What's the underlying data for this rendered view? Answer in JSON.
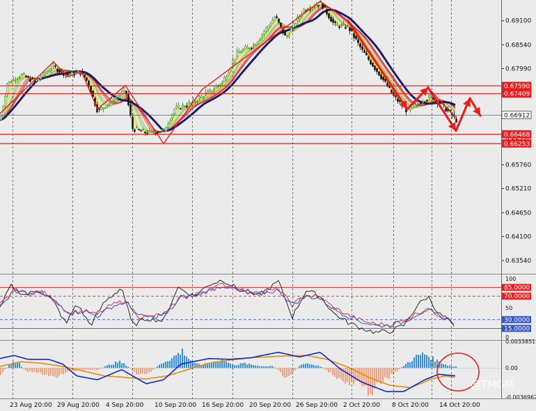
{
  "watermark": "@TMGM",
  "colors": {
    "background": "#ebebeb",
    "bull_candle": "#2a8a2a",
    "bear_candle": "#111111",
    "ma_slow": "#1c1c6b",
    "zigzag": "#ee1c1c",
    "hline_red": "#ee1c1c",
    "hline_blue": "#3355cc",
    "macd_line": "#0a2ad0",
    "signal_line": "#f08a00",
    "hist_pos": "#2f8fe0",
    "hist_neg": "#f4a07a",
    "stoch_black": "#111111",
    "stoch_red": "#e02020",
    "stoch_blue": "#2040d0"
  },
  "chart_data": [
    {
      "type": "candlestick",
      "panel": "price",
      "y_ticks": [
        "0.69100",
        "0.68540",
        "0.67990",
        "0.67440",
        "0.66890",
        "0.66340",
        "0.65760",
        "0.65210",
        "0.64650",
        "0.64100",
        "0.63540"
      ],
      "ylim": [
        0.6325,
        0.6958
      ],
      "x_ticks": [
        "23 Aug 20:00",
        "29 Aug 20:00",
        "4 Sep 20:00",
        "10 Sep 20:00",
        "16 Sep 20:00",
        "20 Sep 20:00",
        "26 Sep 20:00",
        "2 Oct 20:00",
        "8 Oct 20:00",
        "14 Oct 20:00"
      ],
      "price_path": [
        [
          0,
          0.668
        ],
        [
          10,
          0.6765
        ],
        [
          30,
          0.6785
        ],
        [
          50,
          0.6768
        ],
        [
          75,
          0.6805
        ],
        [
          95,
          0.6785
        ],
        [
          115,
          0.679
        ],
        [
          125,
          0.677
        ],
        [
          140,
          0.67
        ],
        [
          160,
          0.6725
        ],
        [
          180,
          0.675
        ],
        [
          190,
          0.666
        ],
        [
          210,
          0.665
        ],
        [
          235,
          0.6655
        ],
        [
          250,
          0.6705
        ],
        [
          275,
          0.672
        ],
        [
          300,
          0.6745
        ],
        [
          320,
          0.677
        ],
        [
          340,
          0.6835
        ],
        [
          365,
          0.6855
        ],
        [
          395,
          0.692
        ],
        [
          410,
          0.687
        ],
        [
          435,
          0.6935
        ],
        [
          460,
          0.6952
        ],
        [
          480,
          0.69
        ],
        [
          500,
          0.6895
        ],
        [
          520,
          0.684
        ],
        [
          545,
          0.6785
        ],
        [
          565,
          0.6735
        ],
        [
          585,
          0.67
        ],
        [
          600,
          0.672
        ],
        [
          620,
          0.6735
        ],
        [
          640,
          0.6705
        ],
        [
          655,
          0.668
        ]
      ],
      "zigzag": [
        [
          0,
          0.6695
        ],
        [
          77,
          0.6815
        ],
        [
          97,
          0.678
        ],
        [
          117,
          0.6792
        ],
        [
          140,
          0.6705
        ],
        [
          180,
          0.676
        ],
        [
          235,
          0.6625
        ],
        [
          290,
          0.675
        ],
        [
          460,
          0.6955
        ],
        [
          500,
          0.691
        ],
        [
          585,
          0.6705
        ],
        [
          615,
          0.6755
        ],
        [
          655,
          0.6685
        ]
      ],
      "projection_arrows": [
        [
          [
            500,
            0.691
          ],
          [
            585,
            0.6705
          ]
        ],
        [
          [
            585,
            0.6705
          ],
          [
            615,
            0.6755
          ]
        ],
        [
          [
            615,
            0.6755
          ],
          [
            655,
            0.6655
          ]
        ],
        [
          [
            655,
            0.6655
          ],
          [
            675,
            0.673
          ]
        ],
        [
          [
            675,
            0.673
          ],
          [
            690,
            0.669
          ]
        ]
      ],
      "hlines": [
        {
          "value": 0.6759,
          "label": "0.67590",
          "color": "#ee1c1c"
        },
        {
          "value": 0.67409,
          "label": "0.67409",
          "color": "#ee1c1c"
        },
        {
          "value": 0.66912,
          "label": "0.66912",
          "color": "#3355cc",
          "current": true
        },
        {
          "value": 0.66468,
          "label": "0.66468",
          "color": "#ee1c1c"
        },
        {
          "value": 0.66253,
          "label": "0.66253",
          "color": "#ee1c1c"
        }
      ]
    },
    {
      "type": "line",
      "panel": "oscillator",
      "ylim": [
        0,
        100
      ],
      "y_ticks": [
        "100",
        "50",
        "0"
      ],
      "levels": [
        {
          "value": 85,
          "label": "85.0000",
          "color": "#ee1c1c",
          "dash": false
        },
        {
          "value": 70,
          "label": "70.0000",
          "color": "#ee1c1c",
          "dash": true
        },
        {
          "value": 30,
          "label": "30.0000",
          "color": "#3355cc",
          "dash": true
        },
        {
          "value": 15,
          "label": "15.0000",
          "color": "#3355cc",
          "dash": false
        }
      ],
      "series": [
        {
          "color": "#111111",
          "points": [
            [
              0,
              48
            ],
            [
              15,
              88
            ],
            [
              35,
              72
            ],
            [
              55,
              80
            ],
            [
              75,
              65
            ],
            [
              95,
              22
            ],
            [
              110,
              58
            ],
            [
              130,
              20
            ],
            [
              150,
              60
            ],
            [
              175,
              85
            ],
            [
              190,
              20
            ],
            [
              210,
              32
            ],
            [
              235,
              28
            ],
            [
              255,
              85
            ],
            [
              280,
              70
            ],
            [
              300,
              90
            ],
            [
              320,
              98
            ],
            [
              345,
              80
            ],
            [
              370,
              70
            ],
            [
              400,
              95
            ],
            [
              420,
              35
            ],
            [
              440,
              80
            ],
            [
              460,
              70
            ],
            [
              480,
              40
            ],
            [
              500,
              25
            ],
            [
              520,
              15
            ],
            [
              540,
              8
            ],
            [
              560,
              10
            ],
            [
              580,
              20
            ],
            [
              600,
              55
            ],
            [
              615,
              70
            ],
            [
              630,
              40
            ],
            [
              645,
              30
            ],
            [
              655,
              10
            ]
          ]
        },
        {
          "color": "#e02020",
          "points": [
            [
              0,
              55
            ],
            [
              20,
              80
            ],
            [
              40,
              75
            ],
            [
              60,
              78
            ],
            [
              80,
              62
            ],
            [
              100,
              40
            ],
            [
              120,
              45
            ],
            [
              140,
              38
            ],
            [
              160,
              55
            ],
            [
              180,
              62
            ],
            [
              200,
              35
            ],
            [
              220,
              35
            ],
            [
              240,
              42
            ],
            [
              260,
              70
            ],
            [
              280,
              72
            ],
            [
              300,
              82
            ],
            [
              320,
              90
            ],
            [
              345,
              82
            ],
            [
              370,
              75
            ],
            [
              400,
              82
            ],
            [
              420,
              55
            ],
            [
              440,
              72
            ],
            [
              460,
              68
            ],
            [
              480,
              50
            ],
            [
              500,
              38
            ],
            [
              520,
              28
            ],
            [
              540,
              22
            ],
            [
              560,
              22
            ],
            [
              580,
              28
            ],
            [
              600,
              42
            ],
            [
              615,
              48
            ],
            [
              630,
              38
            ],
            [
              645,
              32
            ],
            [
              655,
              22
            ]
          ]
        },
        {
          "color": "#2040d0",
          "points": [
            [
              0,
              52
            ],
            [
              20,
              78
            ],
            [
              40,
              74
            ],
            [
              60,
              76
            ],
            [
              80,
              60
            ],
            [
              100,
              42
            ],
            [
              120,
              45
            ],
            [
              140,
              36
            ],
            [
              160,
              52
            ],
            [
              180,
              60
            ],
            [
              200,
              36
            ],
            [
              220,
              34
            ],
            [
              240,
              40
            ],
            [
              260,
              68
            ],
            [
              280,
              70
            ],
            [
              300,
              80
            ],
            [
              320,
              88
            ],
            [
              345,
              80
            ],
            [
              370,
              74
            ],
            [
              400,
              80
            ],
            [
              420,
              56
            ],
            [
              440,
              70
            ],
            [
              460,
              66
            ],
            [
              480,
              48
            ],
            [
              500,
              36
            ],
            [
              520,
              26
            ],
            [
              540,
              20
            ],
            [
              560,
              20
            ],
            [
              580,
              26
            ],
            [
              600,
              40
            ],
            [
              615,
              46
            ],
            [
              630,
              36
            ],
            [
              645,
              30
            ],
            [
              655,
              24
            ]
          ]
        }
      ]
    },
    {
      "type": "bar",
      "panel": "macd",
      "ylim": [
        -0.0036962,
        0.0033851
      ],
      "y_ticks": [
        "0.0033851",
        "0.00",
        "-0.0036962"
      ],
      "histogram": [
        [
          0,
          -0.0008
        ],
        [
          15,
          0.0006
        ],
        [
          25,
          0.0008
        ],
        [
          35,
          -0.0004
        ],
        [
          50,
          -0.0006
        ],
        [
          65,
          -0.0008
        ],
        [
          80,
          -0.0013
        ],
        [
          95,
          -0.0005
        ],
        [
          110,
          -0.0003
        ],
        [
          125,
          -0.0002
        ],
        [
          140,
          -0.0003
        ],
        [
          150,
          0.0002
        ],
        [
          160,
          0.0005
        ],
        [
          170,
          0.0008
        ],
        [
          180,
          0.0004
        ],
        [
          190,
          -0.0004
        ],
        [
          200,
          -0.001
        ],
        [
          215,
          -0.0006
        ],
        [
          225,
          0.0002
        ],
        [
          235,
          0.0008
        ],
        [
          245,
          0.0012
        ],
        [
          255,
          0.0018
        ],
        [
          262,
          0.0022
        ],
        [
          270,
          0.0012
        ],
        [
          280,
          0.0005
        ],
        [
          290,
          0.0004
        ],
        [
          300,
          0.0006
        ],
        [
          310,
          0.0009
        ],
        [
          320,
          0.001
        ],
        [
          330,
          0.0005
        ],
        [
          340,
          0.0004
        ],
        [
          350,
          0.0006
        ],
        [
          360,
          0.0004
        ],
        [
          370,
          0.0003
        ],
        [
          380,
          0.0002
        ],
        [
          390,
          0.0003
        ],
        [
          400,
          -0.0004
        ],
        [
          410,
          -0.0012
        ],
        [
          420,
          -0.0006
        ],
        [
          430,
          0.0004
        ],
        [
          440,
          0.0006
        ],
        [
          450,
          0.0004
        ],
        [
          460,
          0.0002
        ],
        [
          470,
          -0.0004
        ],
        [
          480,
          -0.001
        ],
        [
          490,
          -0.0016
        ],
        [
          500,
          -0.0022
        ],
        [
          510,
          -0.0018
        ],
        [
          520,
          -0.0026
        ],
        [
          530,
          -0.003
        ],
        [
          540,
          -0.0024
        ],
        [
          550,
          -0.0016
        ],
        [
          560,
          -0.001
        ],
        [
          570,
          -0.0004
        ],
        [
          580,
          0.0004
        ],
        [
          590,
          0.001
        ],
        [
          600,
          0.0016
        ],
        [
          610,
          0.0018
        ],
        [
          620,
          0.0012
        ],
        [
          630,
          0.0008
        ],
        [
          640,
          0.0004
        ],
        [
          650,
          0.0002
        ]
      ],
      "macd_line": [
        [
          0,
          0.0012
        ],
        [
          20,
          0.0016
        ],
        [
          40,
          0.0011
        ],
        [
          70,
          0.0011
        ],
        [
          90,
          0.0005
        ],
        [
          110,
          -0.001
        ],
        [
          140,
          -0.0015
        ],
        [
          175,
          -0.0002
        ],
        [
          210,
          -0.002
        ],
        [
          235,
          -0.0015
        ],
        [
          260,
          0.0005
        ],
        [
          300,
          0.0012
        ],
        [
          330,
          0.0011
        ],
        [
          360,
          0.0013
        ],
        [
          400,
          0.002
        ],
        [
          430,
          0.0014
        ],
        [
          460,
          0.002
        ],
        [
          490,
          -0.0002
        ],
        [
          520,
          -0.0018
        ],
        [
          555,
          -0.003
        ],
        [
          580,
          -0.003
        ],
        [
          610,
          -0.0015
        ],
        [
          630,
          -0.0008
        ],
        [
          655,
          -0.001
        ]
      ],
      "signal_line": [
        [
          0,
          0.0002
        ],
        [
          30,
          0.0008
        ],
        [
          60,
          0.0006
        ],
        [
          90,
          0.0002
        ],
        [
          120,
          -0.0004
        ],
        [
          150,
          -0.001
        ],
        [
          180,
          -0.0012
        ],
        [
          210,
          -0.0014
        ],
        [
          240,
          -0.001
        ],
        [
          270,
          -0.0002
        ],
        [
          300,
          0.0006
        ],
        [
          330,
          0.001
        ],
        [
          360,
          0.0013
        ],
        [
          400,
          0.0015
        ],
        [
          440,
          0.0016
        ],
        [
          470,
          0.0011
        ],
        [
          500,
          0.0001
        ],
        [
          530,
          -0.0012
        ],
        [
          560,
          -0.0022
        ],
        [
          590,
          -0.0025
        ],
        [
          620,
          -0.0014
        ],
        [
          640,
          -0.001
        ],
        [
          655,
          -0.0012
        ]
      ]
    }
  ]
}
